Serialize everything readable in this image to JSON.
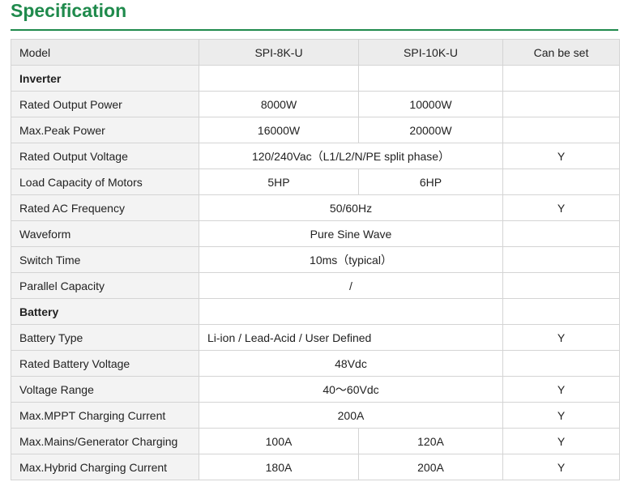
{
  "title": "Specification",
  "table": {
    "headers": [
      "Model",
      "SPI-8K-U",
      "SPI-10K-U",
      "Can be set"
    ],
    "inverter_section": "Inverter",
    "battery_section": "Battery",
    "rows": {
      "rated_output_power": {
        "label": "Rated Output Power",
        "v8k": "8000W",
        "v10k": "10000W",
        "set": ""
      },
      "max_peak_power": {
        "label": "Max.Peak Power",
        "v8k": "16000W",
        "v10k": "20000W",
        "set": ""
      },
      "rated_output_voltage": {
        "label": "Rated Output Voltage",
        "value": "120/240Vac（L1/L2/N/PE split phase）",
        "set": "Y"
      },
      "load_capacity_motors": {
        "label": "Load Capacity of Motors",
        "v8k": "5HP",
        "v10k": "6HP",
        "set": ""
      },
      "rated_ac_frequency": {
        "label": "Rated AC Frequency",
        "value": "50/60Hz",
        "set": "Y"
      },
      "waveform": {
        "label": "Waveform",
        "value": "Pure Sine Wave",
        "set": ""
      },
      "switch_time": {
        "label": "Switch Time",
        "value": "10ms（typical）",
        "set": ""
      },
      "parallel_capacity": {
        "label": "Parallel Capacity",
        "value": "/",
        "set": ""
      },
      "battery_type": {
        "label": "Battery Type",
        "value": "Li-ion / Lead-Acid / User Defined",
        "set": "Y"
      },
      "rated_battery_voltage": {
        "label": "Rated Battery Voltage",
        "value": "48Vdc",
        "set": ""
      },
      "voltage_range": {
        "label": "Voltage Range",
        "value": "40～60Vdc",
        "set": "Y"
      },
      "max_mppt_current": {
        "label": "Max.MPPT Charging Current",
        "value": "200A",
        "set": "Y"
      },
      "max_mains_charging": {
        "label": "Max.Mains/Generator Charging",
        "v8k": "100A",
        "v10k": "120A",
        "set": "Y"
      },
      "max_hybrid_current": {
        "label": "Max.Hybrid Charging Current",
        "v8k": "180A",
        "v10k": "200A",
        "set": "Y"
      }
    }
  }
}
